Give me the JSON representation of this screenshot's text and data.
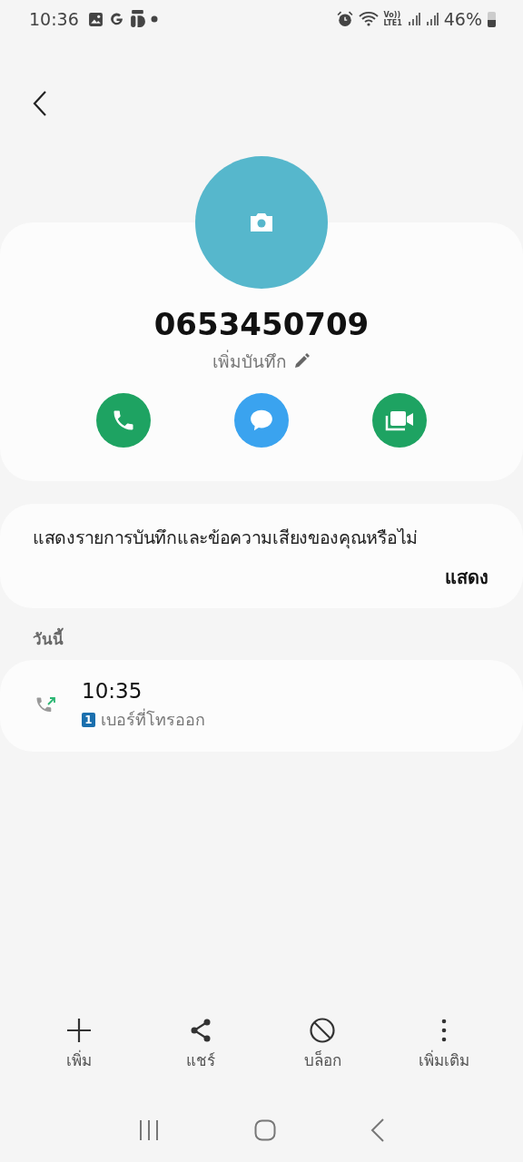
{
  "status_bar": {
    "time": "10:36",
    "network_top": "Vo))",
    "network_bottom": "LTE1",
    "battery_text": "46%"
  },
  "contact": {
    "number": "0653450709",
    "note_placeholder": "เพิ่มบันทึก"
  },
  "actions": [
    {
      "kind": "call",
      "color": "#1ea362"
    },
    {
      "kind": "message",
      "color": "#3aa3ef"
    },
    {
      "kind": "video",
      "color": "#1ea362"
    }
  ],
  "voicemail_card": {
    "text": "แสดงรายการบันทึกและข้อความเสียงของคุณหรือไม่",
    "button": "แสดง"
  },
  "history": {
    "section": "วันนี้",
    "calls": [
      {
        "time": "10:35",
        "sim": "1",
        "type": "เบอร์ที่โทรออก",
        "kind": "outgoing"
      }
    ]
  },
  "bottom_actions": [
    {
      "kind": "add",
      "label": "เพิ่ม"
    },
    {
      "kind": "share",
      "label": "แชร์"
    },
    {
      "kind": "block",
      "label": "บล็อก"
    },
    {
      "kind": "more",
      "label": "เพิ่มเติม"
    }
  ]
}
